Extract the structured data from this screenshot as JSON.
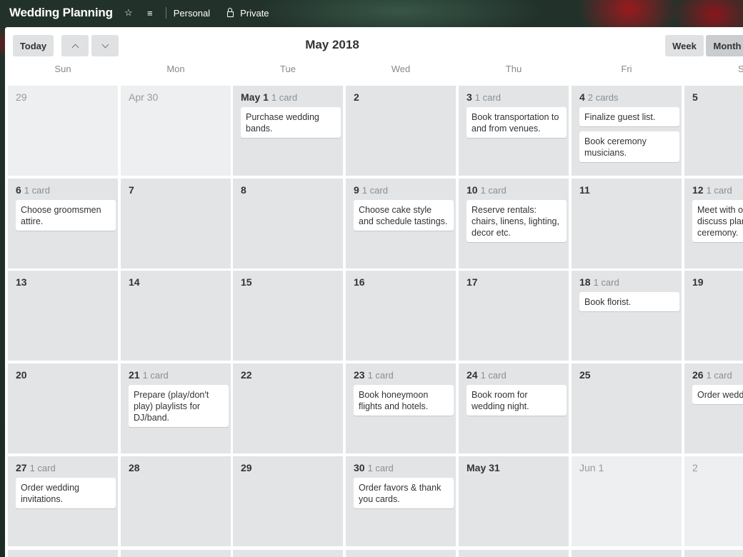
{
  "header": {
    "board_title": "Wedding Planning",
    "star_icon": "star-icon",
    "menu_icon": "menu-icon",
    "team_label": "Personal",
    "lock_icon": "lock-icon",
    "visibility_label": "Private"
  },
  "toolbar": {
    "today_label": "Today",
    "prev_icon": "chevron-up-icon",
    "next_icon": "chevron-down-icon",
    "month_title": "May 2018",
    "week_label": "Week",
    "month_label": "Month"
  },
  "weekdays": [
    "Sun",
    "Mon",
    "Tue",
    "Wed",
    "Thu",
    "Fri",
    "S"
  ],
  "weeks": [
    [
      {
        "day": "29",
        "other": true,
        "count": "",
        "cards": []
      },
      {
        "day": "Apr 30",
        "other": true,
        "count": "",
        "cards": []
      },
      {
        "day": "May 1",
        "count": "1 card",
        "cards": [
          "Purchase wedding bands."
        ]
      },
      {
        "day": "2",
        "count": "",
        "cards": []
      },
      {
        "day": "3",
        "count": "1 card",
        "cards": [
          "Book transportation to and from venues."
        ]
      },
      {
        "day": "4",
        "count": "2 cards",
        "cards": [
          "Finalize guest list.",
          "Book ceremony musicians."
        ]
      },
      {
        "day": "5",
        "count": "",
        "cards": []
      }
    ],
    [
      {
        "day": "6",
        "count": "1 card",
        "cards": [
          "Choose groomsmen attire."
        ]
      },
      {
        "day": "7",
        "count": "",
        "cards": []
      },
      {
        "day": "8",
        "count": "",
        "cards": []
      },
      {
        "day": "9",
        "count": "1 card",
        "cards": [
          "Choose cake style and schedule tastings."
        ]
      },
      {
        "day": "10",
        "count": "1 card",
        "cards": [
          "Reserve rentals: chairs, linens, lighting, decor etc."
        ]
      },
      {
        "day": "11",
        "count": "",
        "cards": []
      },
      {
        "day": "12",
        "count": "1 card",
        "cards": [
          "Meet with of\ndiscuss plan\nceremony."
        ]
      }
    ],
    [
      {
        "day": "13",
        "count": "",
        "cards": []
      },
      {
        "day": "14",
        "count": "",
        "cards": []
      },
      {
        "day": "15",
        "count": "",
        "cards": []
      },
      {
        "day": "16",
        "count": "",
        "cards": []
      },
      {
        "day": "17",
        "count": "",
        "cards": []
      },
      {
        "day": "18",
        "count": "1 card",
        "cards": [
          "Book florist."
        ]
      },
      {
        "day": "19",
        "count": "",
        "cards": []
      }
    ],
    [
      {
        "day": "20",
        "count": "",
        "cards": []
      },
      {
        "day": "21",
        "count": "1 card",
        "cards": [
          "Prepare (play/don't play) playlists for DJ/band."
        ]
      },
      {
        "day": "22",
        "count": "",
        "cards": []
      },
      {
        "day": "23",
        "count": "1 card",
        "cards": [
          "Book honeymoon flights and hotels."
        ]
      },
      {
        "day": "24",
        "count": "1 card",
        "cards": [
          "Book room for wedding night."
        ]
      },
      {
        "day": "25",
        "count": "",
        "cards": []
      },
      {
        "day": "26",
        "count": "1 card",
        "cards": [
          "Order weddi"
        ]
      }
    ],
    [
      {
        "day": "27",
        "count": "1 card",
        "cards": [
          "Order wedding invitations."
        ]
      },
      {
        "day": "28",
        "count": "",
        "cards": []
      },
      {
        "day": "29",
        "count": "",
        "cards": []
      },
      {
        "day": "30",
        "count": "1 card",
        "cards": [
          "Order favors & thank you cards."
        ]
      },
      {
        "day": "May 31",
        "count": "",
        "cards": []
      },
      {
        "day": "Jun 1",
        "other": true,
        "count": "",
        "cards": []
      },
      {
        "day": "2",
        "other": true,
        "count": "",
        "cards": []
      }
    ]
  ]
}
